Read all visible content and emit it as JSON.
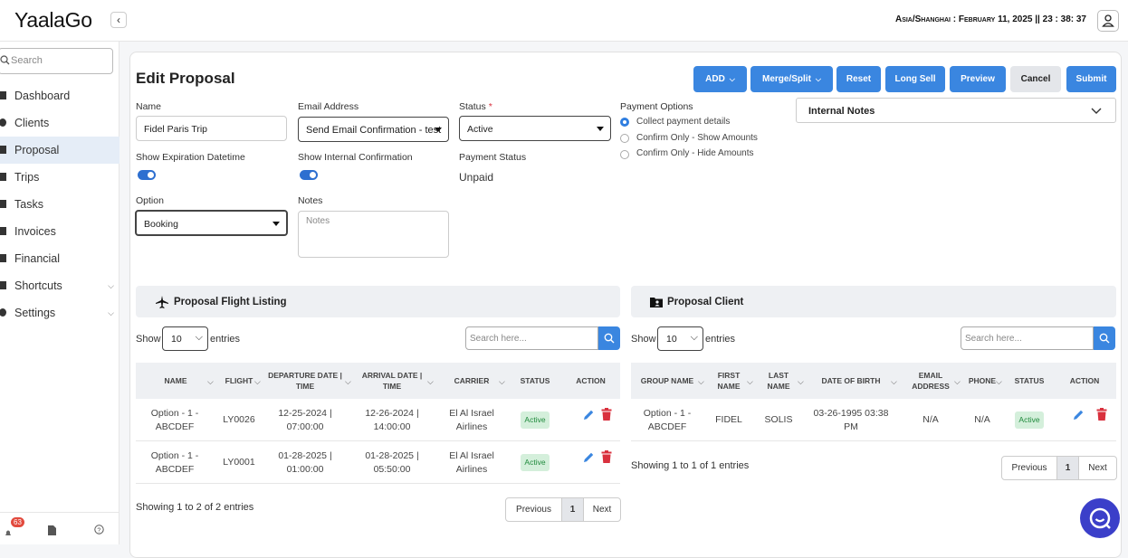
{
  "app": {
    "logo": "YaalaGo",
    "timezone_clock": "Asia/Shanghai : February 11, 2025 || 23 : 38: 37"
  },
  "sidebar": {
    "search_placeholder": "Search",
    "items": [
      {
        "label": "Dashboard"
      },
      {
        "label": "Clients"
      },
      {
        "label": "Proposal"
      },
      {
        "label": "Trips"
      },
      {
        "label": "Tasks"
      },
      {
        "label": "Invoices"
      },
      {
        "label": "Financial"
      },
      {
        "label": "Shortcuts"
      },
      {
        "label": "Settings"
      }
    ],
    "notification_count": "63"
  },
  "page": {
    "title": "Edit Proposal"
  },
  "toolbar": {
    "add": "ADD",
    "merge": "Merge/Split",
    "reset": "Reset",
    "long_sell": "Long Sell",
    "preview": "Preview",
    "cancel": "Cancel",
    "submit": "Submit"
  },
  "form": {
    "name_label": "Name",
    "name_value": "Fidel Paris Trip",
    "email_label": "Email Address",
    "email_value": "Send Email Confirmation - test",
    "status_label": "Status",
    "status_required": "*",
    "status_value": "Active",
    "payment_options_label": "Payment Options",
    "payment_options": [
      "Collect payment details",
      "Confirm Only - Show Amounts",
      "Confirm Only - Hide Amounts"
    ],
    "show_expiration_label": "Show Expiration Datetime",
    "show_internal_label": "Show Internal Confirmation",
    "payment_status_label": "Payment Status",
    "payment_status_value": "Unpaid",
    "option_label": "Option",
    "option_value": "Booking",
    "notes_label": "Notes",
    "notes_placeholder": "Notes",
    "internal_notes": "Internal Notes"
  },
  "flights": {
    "title": "Proposal Flight Listing",
    "show": "Show",
    "entries_value": "10",
    "entries": "entries",
    "search_placeholder": "Search here...",
    "columns": [
      "NAME",
      "FLIGHT",
      "DEPARTURE DATE | TIME",
      "ARRIVAL DATE | TIME",
      "CARRIER",
      "STATUS",
      "ACTION"
    ],
    "rows": [
      {
        "name": "Option - 1 - ABCDEF",
        "flight": "LY0026",
        "departure": "12-25-2024 | 07:00:00",
        "arrival": "12-26-2024 | 14:00:00",
        "carrier": "El Al Israel Airlines",
        "status": "Active"
      },
      {
        "name": "Option - 1 - ABCDEF",
        "flight": "LY0001",
        "departure": "01-28-2025 | 01:00:00",
        "arrival": "01-28-2025 | 05:50:00",
        "carrier": "El Al Israel Airlines",
        "status": "Active"
      }
    ],
    "info": "Showing 1 to 2 of 2 entries",
    "prev": "Previous",
    "page": "1",
    "next": "Next"
  },
  "clients": {
    "title": "Proposal Client",
    "show": "Show",
    "entries_value": "10",
    "entries": "entries",
    "search_placeholder": "Search here...",
    "columns": [
      "GROUP NAME",
      "FIRST NAME",
      "LAST NAME",
      "DATE OF BIRTH",
      "EMAIL ADDRESS",
      "PHONE",
      "STATUS",
      "ACTION"
    ],
    "rows": [
      {
        "group": "Option - 1 - ABCDEF",
        "first": "FIDEL",
        "last": "SOLIS",
        "dob": "03-26-1995 03:38 PM",
        "email": "N/A",
        "phone": "N/A",
        "status": "Active"
      }
    ],
    "info": "Showing 1 to 1 of 1 entries",
    "prev": "Previous",
    "page": "1",
    "next": "Next"
  },
  "colors": {
    "accent": "#3a86e0",
    "active_nav": "#e5edf7",
    "status_active_bg": "#d4efdb",
    "delete": "#d9313e",
    "chat_fab": "#3b3fc9"
  }
}
